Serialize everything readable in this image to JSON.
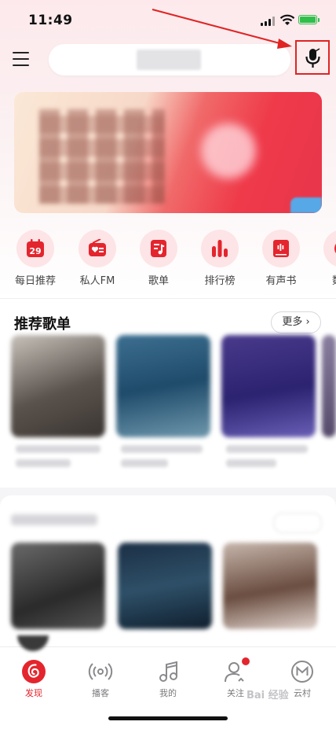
{
  "status_bar": {
    "time": "11:49"
  },
  "quick_nav": [
    {
      "label": "每日推荐",
      "icon": "calendar-icon",
      "day": "29"
    },
    {
      "label": "私人FM",
      "icon": "radio-icon"
    },
    {
      "label": "歌单",
      "icon": "playlist-icon"
    },
    {
      "label": "排行榜",
      "icon": "chart-bars-icon"
    },
    {
      "label": "有声书",
      "icon": "audiobook-icon"
    },
    {
      "label": "数字",
      "icon": "album-icon"
    }
  ],
  "section_playlists": {
    "title": "推荐歌单",
    "more_label": "更多"
  },
  "tab_bar": [
    {
      "label": "发现",
      "icon": "netease-logo-icon",
      "active": true
    },
    {
      "label": "播客",
      "icon": "podcast-icon"
    },
    {
      "label": "我的",
      "icon": "music-note-icon"
    },
    {
      "label": "关注",
      "icon": "follow-icon",
      "badge": true
    },
    {
      "label": "云村",
      "icon": "cloud-village-icon"
    }
  ],
  "watermark": "Bai 经验",
  "colors": {
    "accent": "#e4252d",
    "annotation": "#e02424"
  }
}
